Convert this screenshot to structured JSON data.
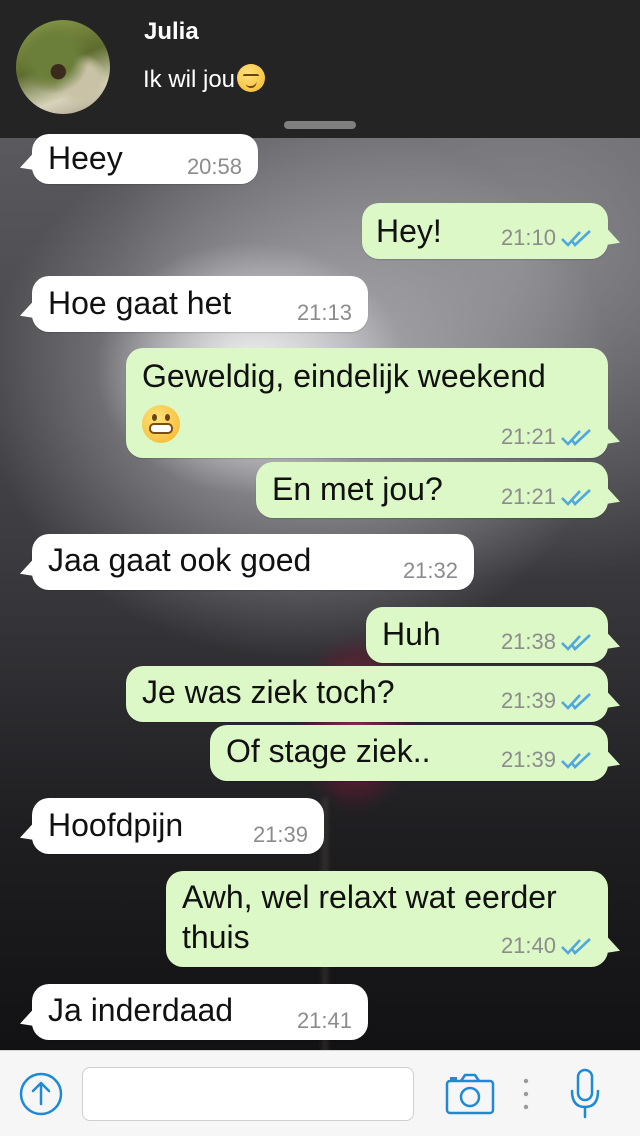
{
  "header": {
    "contact_name": "Julia",
    "contact_status": "Ik wil jou",
    "status_emoji": "smirking-face"
  },
  "messages": [
    {
      "direction": "in",
      "text": "Heey",
      "time": "20:58"
    },
    {
      "direction": "out",
      "text": "Hey!",
      "time": "21:10",
      "read": true
    },
    {
      "direction": "in",
      "text": "Hoe gaat het",
      "time": "21:13"
    },
    {
      "direction": "out",
      "text": "Geweldig, eindelijk weekend",
      "emoji": "grinning-face",
      "time": "21:21",
      "read": true
    },
    {
      "direction": "out",
      "text": "En met jou?",
      "time": "21:21",
      "read": true
    },
    {
      "direction": "in",
      "text": "Jaa gaat ook goed",
      "time": "21:32"
    },
    {
      "direction": "out",
      "text": "Huh",
      "time": "21:38",
      "read": true
    },
    {
      "direction": "out",
      "text": "Je was ziek toch?",
      "time": "21:39",
      "read": true
    },
    {
      "direction": "out",
      "text": "Of stage ziek..",
      "time": "21:39",
      "read": true
    },
    {
      "direction": "in",
      "text": "Hoofdpijn",
      "time": "21:39"
    },
    {
      "direction": "out",
      "text_lines": [
        "Awh, wel relaxt wat eerder",
        "thuis"
      ],
      "time": "21:40",
      "read": true
    },
    {
      "direction": "in",
      "text": "Ja inderdaad",
      "time": "21:41"
    }
  ],
  "input_bar": {
    "message_value": "",
    "icons": [
      "upload-arrow-icon",
      "camera-icon",
      "more-dots-icon",
      "microphone-icon"
    ]
  },
  "colors": {
    "header_bg": "#242424",
    "incoming_bubble": "#ffffff",
    "outgoing_bubble": "#dcf8c6",
    "read_ticks": "#4fa8e0",
    "accent": "#1e8ad6"
  }
}
